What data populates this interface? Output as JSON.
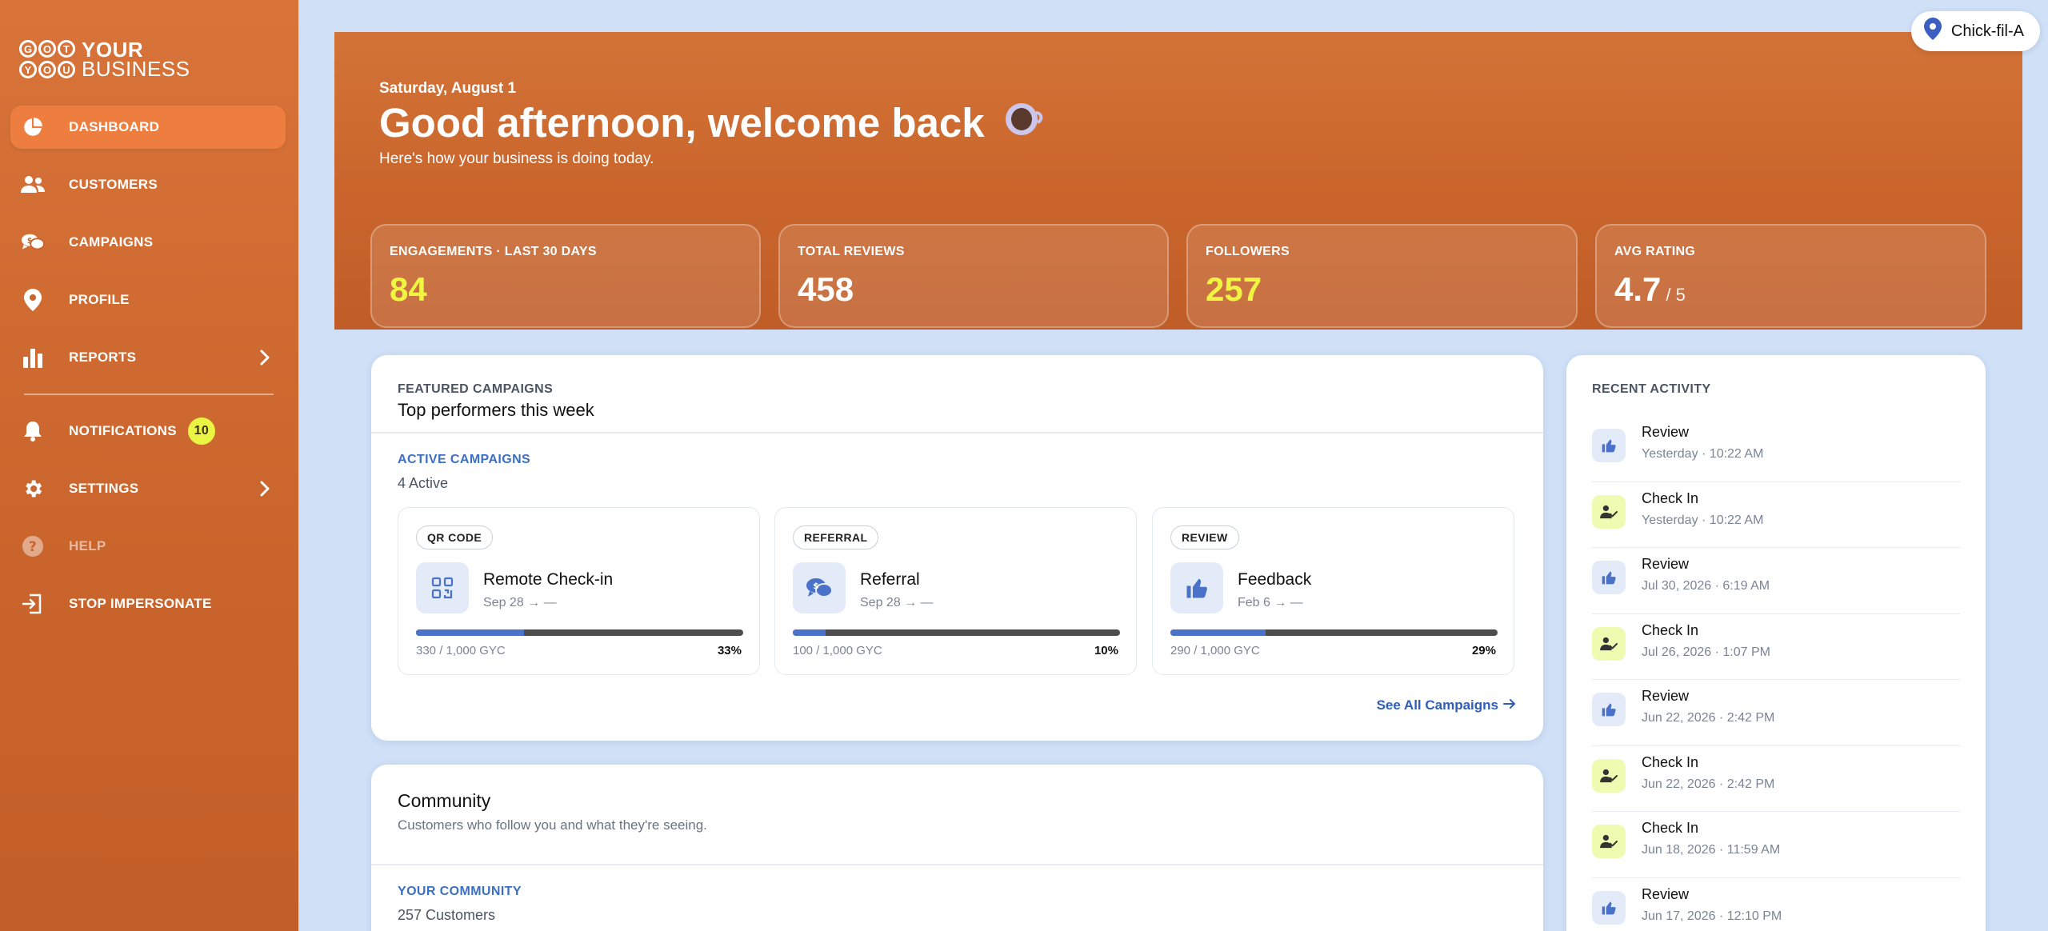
{
  "sidebar": {
    "logo": {
      "c1": "G",
      "c2": "O",
      "c3": "T",
      "c4": "Y",
      "c5": "O",
      "c6": "U",
      "line1": "YOUR",
      "line2": "BUSINESS"
    },
    "items": [
      {
        "label": "DASHBOARD",
        "icon": "pie-chart-icon"
      },
      {
        "label": "CUSTOMERS",
        "icon": "users-icon"
      },
      {
        "label": "CAMPAIGNS",
        "icon": "chat-bubbles-icon"
      },
      {
        "label": "PROFILE",
        "icon": "location-pin-icon"
      },
      {
        "label": "REPORTS",
        "icon": "bar-chart-icon"
      },
      {
        "label": "NOTIFICATIONS",
        "icon": "bell-icon",
        "badge": "10"
      },
      {
        "label": "SETTINGS",
        "icon": "gear-icon"
      },
      {
        "label": "HELP",
        "icon": "help-circle-icon"
      },
      {
        "label": "STOP IMPERSONATE",
        "icon": "exit-icon"
      }
    ]
  },
  "brand_chip": {
    "label": "Chick-fil-A"
  },
  "hero": {
    "date": "Saturday, August 1",
    "title": "Good afternoon, welcome back",
    "subtitle": "Here's how your business is doing today.",
    "stats": [
      {
        "label": "ENGAGEMENTS · LAST 30 DAYS",
        "value": "84"
      },
      {
        "label": "TOTAL REVIEWS",
        "value": "458"
      },
      {
        "label": "FOLLOWERS",
        "value": "257"
      },
      {
        "label": "AVG RATING",
        "value": "4.7",
        "suffix": "/ 5"
      }
    ]
  },
  "featured": {
    "overline": "FEATURED CAMPAIGNS",
    "title": "Top performers this week",
    "active_label": "ACTIVE CAMPAIGNS",
    "active_count": "4 Active",
    "campaigns": [
      {
        "type": "QR CODE",
        "name": "Remote Check-in",
        "dates": "Sep 28 → —",
        "progress": "330 / 1,000 GYC",
        "percent": "33%",
        "fraction": 0.33
      },
      {
        "type": "REFERRAL",
        "name": "Referral",
        "dates": "Sep 28 → —",
        "progress": "100 / 1,000 GYC",
        "percent": "10%",
        "fraction": 0.1
      },
      {
        "type": "REVIEW",
        "name": "Feedback",
        "dates": "Feb 6 → —",
        "progress": "290 / 1,000 GYC",
        "percent": "29%",
        "fraction": 0.29
      }
    ],
    "see_all": "See All Campaigns"
  },
  "community": {
    "title": "Community",
    "subtitle": "Customers who follow you and what they're seeing.",
    "section_label": "YOUR COMMUNITY",
    "count": "257 Customers"
  },
  "activity": {
    "overline": "RECENT ACTIVITY",
    "items": [
      {
        "title": "Review",
        "time": "Yesterday · 10:22 AM",
        "kind": "review"
      },
      {
        "title": "Check In",
        "time": "Yesterday · 10:22 AM",
        "kind": "checkin"
      },
      {
        "title": "Review",
        "time": "Jul 30, 2026 · 6:19 AM",
        "kind": "review"
      },
      {
        "title": "Check In",
        "time": "Jul 26, 2026 · 1:07 PM",
        "kind": "checkin"
      },
      {
        "title": "Review",
        "time": "Jun 22, 2026 · 2:42 PM",
        "kind": "review"
      },
      {
        "title": "Check In",
        "time": "Jun 22, 2026 · 2:42 PM",
        "kind": "checkin"
      },
      {
        "title": "Check In",
        "time": "Jun 18, 2026 · 11:59 AM",
        "kind": "checkin"
      },
      {
        "title": "Review",
        "time": "Jun 17, 2026 · 12:10 PM",
        "kind": "review"
      }
    ]
  },
  "colors": {
    "brand_orange": "#c9652c",
    "active_nav": "#ee7e3f",
    "accent_yellow": "#eff540",
    "link_blue": "#2f5db7",
    "progress_blue": "#4a72c9",
    "page_bg": "#cfe0f7"
  }
}
